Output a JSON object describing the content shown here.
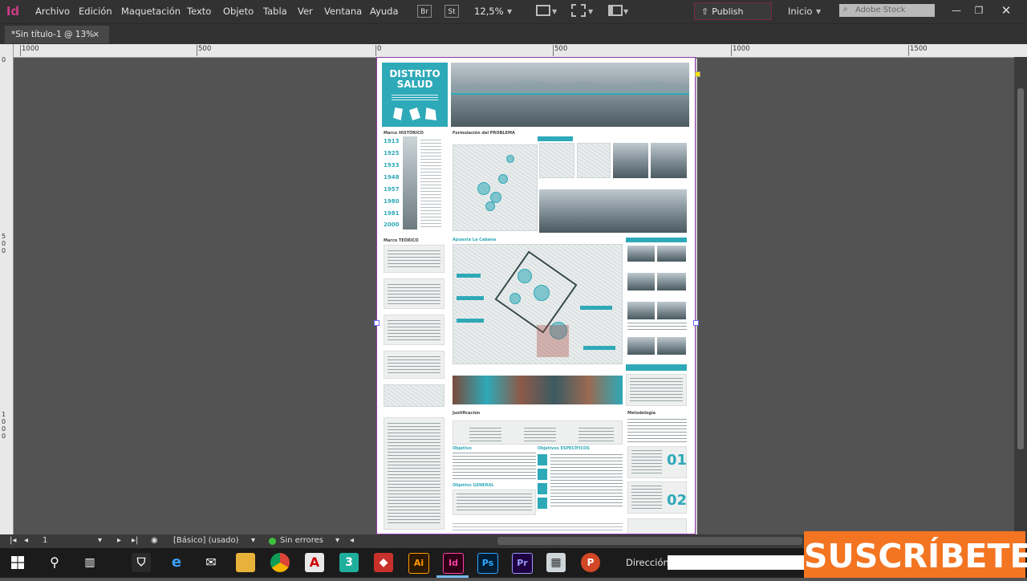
{
  "app": {
    "logo": "Id"
  },
  "menu": [
    "Archivo",
    "Edición",
    "Maquetación",
    "Texto",
    "Objeto",
    "Tabla",
    "Ver",
    "Ventana",
    "Ayuda"
  ],
  "toolbar": {
    "br": "Br",
    "st": "St",
    "zoom": "12,5%",
    "publish": "Publish Online",
    "workspace": "Inicio",
    "search_placeholder": "Adobe Stock"
  },
  "tab": {
    "title": "*Sin título-1 @ 13%",
    "close": "×"
  },
  "ruler": {
    "top": [
      "1000",
      "500",
      "0",
      "500",
      "1000",
      "1500"
    ],
    "left": [
      "0",
      "5 0 0",
      "1 0 0 0"
    ]
  },
  "poster": {
    "title_line1": "DISTRITO",
    "title_line2": "SALUD",
    "years": [
      "1913",
      "1925",
      "1933",
      "1948",
      "1957",
      "1980",
      "1981",
      "2000"
    ],
    "section_hist": "Marco HISTÓRICO",
    "section_teor": "Marco TEÓRICO",
    "section_form": "Formulación del PROBLEMA",
    "section_prop": "Apuesta La Cabana",
    "section_just": "Justificación",
    "section_meto": "Metodología",
    "num1": "01",
    "num2": "02",
    "obj_general": "Objetivo GENERAL",
    "obj_especificos": "Objetivos ESPECÍFICOS",
    "objetivo": "Objetivo"
  },
  "status": {
    "page": "1",
    "style": "[Básico] (usado)",
    "errors": "Sin errores"
  },
  "taskbar": {
    "direccion": "Dirección"
  },
  "banner": {
    "text": "SUSCRÍBETE"
  },
  "colors": {
    "accent": "#2ea9b8",
    "subscribe": "#f37421",
    "frame": "#8f3aa6"
  }
}
